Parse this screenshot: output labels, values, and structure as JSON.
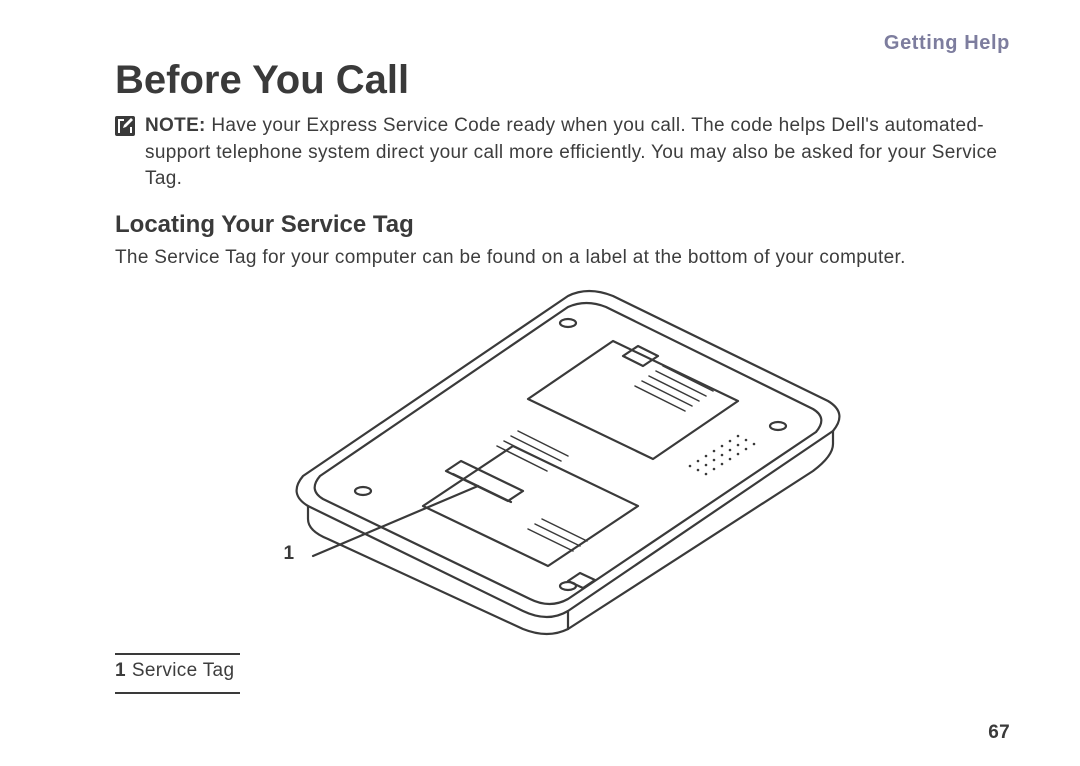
{
  "section": "Getting Help",
  "title": "Before You Call",
  "note": {
    "label": "NOTE:",
    "text": "Have your Express Service Code ready when you call. The code helps Dell's automated-support telephone system direct your call more efficiently. You may also be asked for your Service Tag."
  },
  "subheading": "Locating Your Service Tag",
  "body": "The Service Tag for your computer can be found on a label at the bottom of your computer.",
  "diagram": {
    "callout_number": "1",
    "legend": [
      {
        "index": "1",
        "label": "Service Tag"
      }
    ]
  },
  "page_number": "67"
}
